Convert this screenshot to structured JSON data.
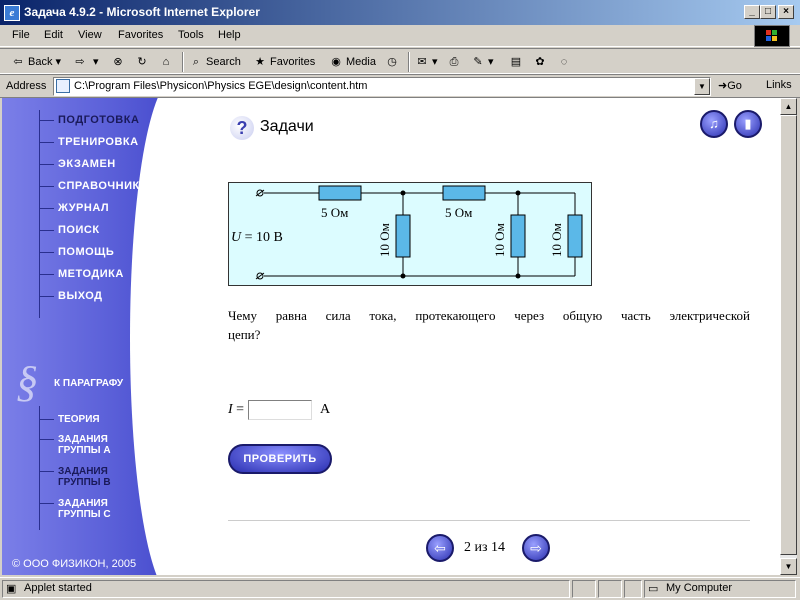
{
  "window": {
    "title": "Задача 4.9.2 - Microsoft Internet Explorer",
    "controls": {
      "minimize": "_",
      "maximize": "□",
      "close": "×"
    }
  },
  "menu": [
    "File",
    "Edit",
    "View",
    "Favorites",
    "Tools",
    "Help"
  ],
  "toolbar": {
    "back": "Back",
    "search": "Search",
    "favorites": "Favorites",
    "media": "Media"
  },
  "address": {
    "label": "Address",
    "value": "C:\\Program Files\\Physicon\\Physics EGE\\design\\content.htm",
    "go": "Go",
    "links": "Links"
  },
  "sidebar": {
    "nav": [
      "ПОДГОТОВКА",
      "ТРЕНИРОВКА",
      "ЭКЗАМЕН",
      "СПРАВОЧНИК",
      "ЖУРНАЛ",
      "ПОИСК",
      "ПОМОЩЬ",
      "МЕТОДИКА",
      "ВЫХОД"
    ],
    "paragraph_symbol": "§",
    "paragraph_label": "К ПАРАГРАФУ",
    "sub": [
      {
        "line1": "ТЕОРИЯ",
        "line2": ""
      },
      {
        "line1": "ЗАДАНИЯ",
        "line2": "ГРУППЫ А"
      },
      {
        "line1": "ЗАДАНИЯ",
        "line2": "ГРУППЫ В"
      },
      {
        "line1": "ЗАДАНИЯ",
        "line2": "ГРУППЫ С"
      }
    ],
    "copyright": "© ООО ФИЗИКОН, 2005"
  },
  "header": {
    "icon": "?",
    "title": "Задачи"
  },
  "circuit": {
    "voltage_var": "U",
    "voltage_val": " = 10 В",
    "r1": "5 Ом",
    "r2": "5 Ом",
    "r3": "10 Ом",
    "r4": "10 Ом",
    "r5": "10 Ом"
  },
  "question": {
    "line1": "Чему равна сила тока, протекающего через общую часть электрической",
    "line2": "цепи?"
  },
  "answer": {
    "var": "I",
    "eq": " =",
    "unit": "А",
    "value": ""
  },
  "check_button": "ПРОВЕРИТЬ",
  "pager": {
    "text": "2 из 14"
  },
  "status": {
    "text": "Applet started",
    "zone": "My Computer"
  },
  "colors": {
    "accent": "#2a2fb0",
    "sidebar": "#5a5fd8",
    "circuit_bg": "#dcfcff",
    "resistor": "#5bb8e8"
  }
}
